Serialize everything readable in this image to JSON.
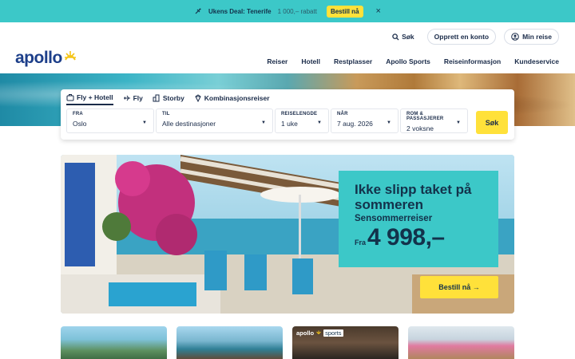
{
  "deal_bar": {
    "label": "Ukens Deal: Tenerife",
    "price_text": "1 000,– rabatt",
    "button_label": "Bestill nå",
    "close_glyph": "×"
  },
  "header": {
    "logo_text": "apollo",
    "search_label": "Søk",
    "create_account_label": "Opprett en konto",
    "my_trip_label": "Min reise",
    "nav": [
      "Reiser",
      "Hotell",
      "Restplasser",
      "Apollo Sports",
      "Reiseinformasjon",
      "Kundeservice"
    ]
  },
  "search_box": {
    "tabs": [
      {
        "label": "Fly + Hotell",
        "icon": "suitcase-icon",
        "active": true
      },
      {
        "label": "Fly",
        "icon": "plane-icon",
        "active": false
      },
      {
        "label": "Storby",
        "icon": "city-icon",
        "active": false
      },
      {
        "label": "Kombinasjonsreiser",
        "icon": "diamond-icon",
        "active": false
      }
    ],
    "fields": [
      {
        "label": "FRA",
        "value": "Oslo"
      },
      {
        "label": "TIL",
        "value": "Alle destinasjoner"
      },
      {
        "label": "REISELENGDE",
        "value": "1 uke"
      },
      {
        "label": "NÅR",
        "value": "7 aug. 2026"
      },
      {
        "label": "ROM & PASSASJERER",
        "value": "2 voksne"
      }
    ],
    "search_button_label": "Søk"
  },
  "promo": {
    "title": "Ikke slipp taket på sommeren",
    "subtitle": "Sensommerreiser",
    "price_prefix": "Fra",
    "price": "4 998,–",
    "button_label": "Bestill nå →"
  },
  "cards": [
    {
      "badge": ""
    },
    {
      "badge": ""
    },
    {
      "badge": "apollo",
      "badge_suffix": "sports"
    },
    {
      "badge": ""
    }
  ],
  "colors": {
    "accent_teal": "#3cc8c8",
    "accent_yellow": "#ffe13a",
    "brand_blue": "#1d3f8a",
    "text_dark": "#1a2b49"
  }
}
